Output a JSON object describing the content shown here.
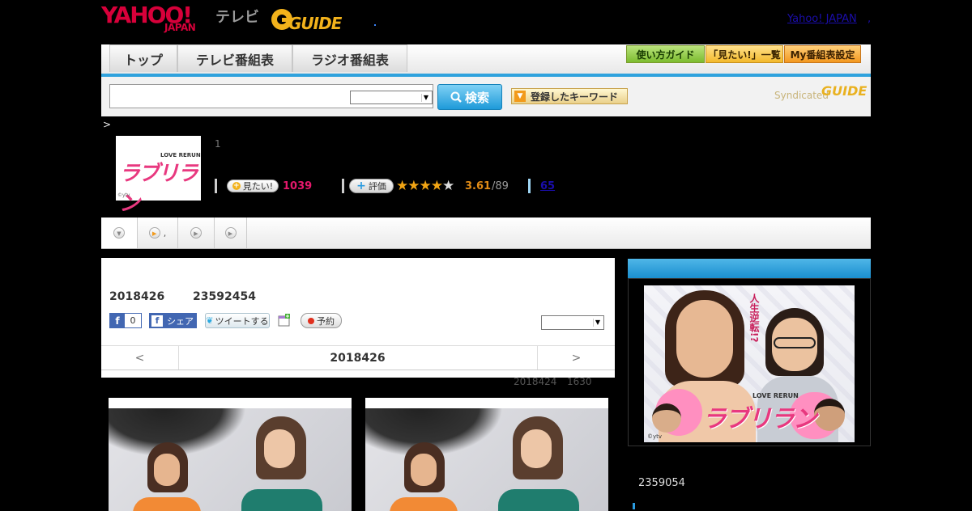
{
  "header": {
    "yahoo_logo": "YAHOO!",
    "yahoo_logo_sub": "JAPAN",
    "tv_label": "テレビ",
    "gguide_logo": "GUIDE",
    "top_link": "Yahoo! JAPAN",
    "top_link_sep": ","
  },
  "nav": {
    "tabs": [
      "トップ",
      "テレビ番組表",
      "ラジオ番組表"
    ],
    "buttons": {
      "guide": "使い方ガイド",
      "watchlist": "「見たい!」一覧",
      "my_schedule": "My番組表設定"
    }
  },
  "search": {
    "input_value": "",
    "select_value": "",
    "search_button": "検索",
    "keyword_button": "登録したキーワード",
    "syndicated_label": "Syndicated",
    "syndicated_logo": "GUIDE"
  },
  "breadcrumb": {
    "separator": ">"
  },
  "program": {
    "thumbnail_title": "ラブリラン",
    "thumbnail_subtitle": "LOVE RERUN",
    "thumbnail_copyright": "©ytv",
    "episode_number": "1",
    "watch_button": "見たい!",
    "watch_count": "1039",
    "rating_button": "評価",
    "rating_stars": 3.61,
    "rating_score": "3.61",
    "rating_total": "/89",
    "review_count": "65"
  },
  "subtabs": {
    "tab2_suffix": ","
  },
  "content": {
    "air_date": "2018426",
    "air_id": "23592454",
    "fb_like_count": "0",
    "fb_share": "シェア",
    "tweet_button": "ツイートする",
    "reserve_button": "予約",
    "select_value": "",
    "date_nav": {
      "prev": "<",
      "date": "2018426",
      "next": ">"
    },
    "meta_date": "2018424",
    "meta_time": "1630"
  },
  "sidebar": {
    "poster_title": "ラブリラン",
    "poster_subtitle": "LOVE RERUN",
    "poster_catch": "人生逆転!?",
    "poster_copyright": "©ytv",
    "program_id": "2359054"
  },
  "colors": {
    "accent_blue": "#2fa2dd",
    "brand_red": "#d7003a",
    "watch_count_pink": "#e6186c",
    "rating_orange": "#e08b16"
  },
  "icons": [
    "search-icon",
    "keyword-arrow-icon",
    "plus-icon",
    "star-icon",
    "play-circle-icon",
    "facebook-icon",
    "twitter-icon",
    "calendar-icon",
    "record-icon",
    "chevron-down-icon"
  ]
}
